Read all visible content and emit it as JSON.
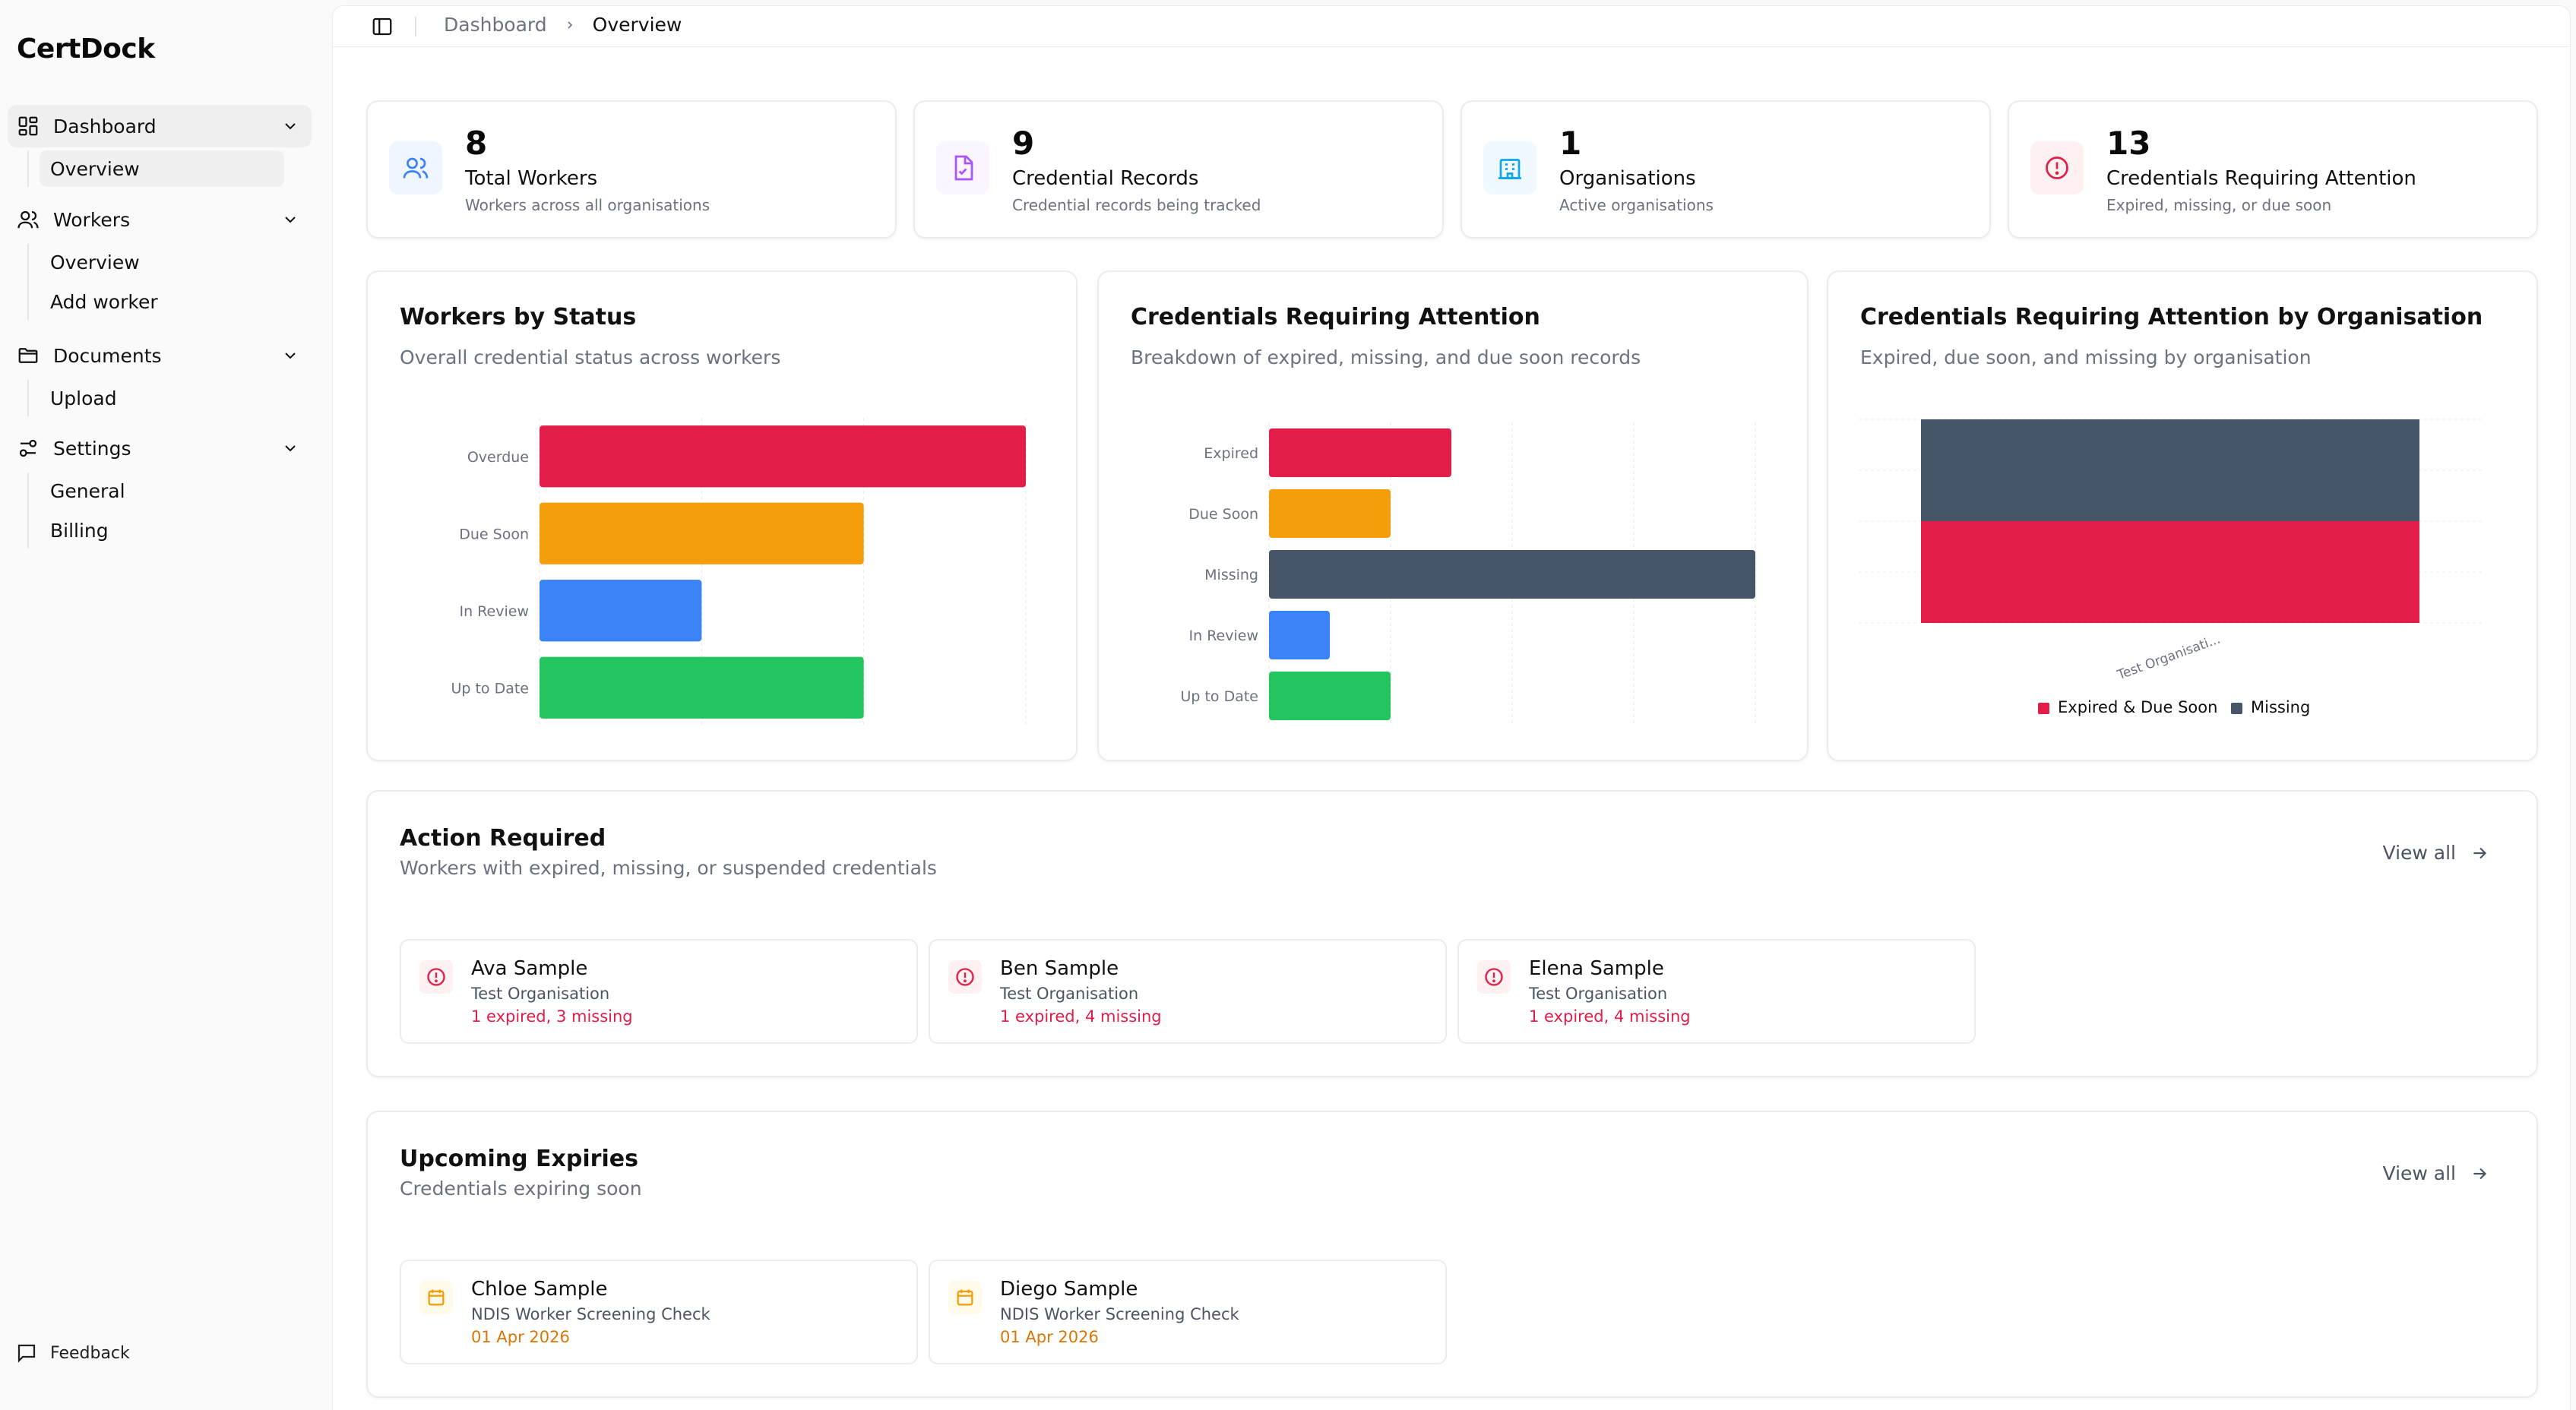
{
  "app": {
    "brand": "CertDock"
  },
  "sidebar": {
    "groups": [
      {
        "label": "Dashboard",
        "icon": "dashboard-icon",
        "items": [
          {
            "label": "Overview"
          }
        ]
      },
      {
        "label": "Workers",
        "icon": "users-icon",
        "items": [
          {
            "label": "Overview"
          },
          {
            "label": "Add worker"
          }
        ]
      },
      {
        "label": "Documents",
        "icon": "folder-icon",
        "items": [
          {
            "label": "Upload"
          }
        ]
      },
      {
        "label": "Settings",
        "icon": "sliders-icon",
        "items": [
          {
            "label": "General"
          },
          {
            "label": "Billing"
          }
        ]
      }
    ],
    "feedback": "Feedback"
  },
  "breadcrumb": {
    "parent": "Dashboard",
    "current": "Overview"
  },
  "stats": [
    {
      "value": "8",
      "label": "Total Workers",
      "desc": "Workers across all organisations",
      "icon": "users-icon",
      "color": "#3b82f6"
    },
    {
      "value": "9",
      "label": "Credential Records",
      "desc": "Credential records being tracked",
      "icon": "file-check-icon",
      "color": "#a855f7"
    },
    {
      "value": "1",
      "label": "Organisations",
      "desc": "Active organisations",
      "icon": "building-icon",
      "color": "#0ea5e9"
    },
    {
      "value": "13",
      "label": "Credentials Requiring Attention",
      "desc": "Expired, missing, or due soon",
      "icon": "alert-circle-icon",
      "color": "#e11d48"
    }
  ],
  "charts": {
    "status": {
      "title": "Workers by Status",
      "subtitle": "Overall credential status across workers"
    },
    "attention": {
      "title": "Credentials Requiring Attention",
      "subtitle": "Breakdown of expired, missing, and due soon records"
    },
    "org": {
      "title": "Credentials Requiring Attention by Organisation",
      "subtitle": "Expired, due soon, and missing by organisation"
    }
  },
  "chart_data": [
    {
      "type": "bar",
      "orientation": "horizontal",
      "title": "Workers by Status",
      "categories": [
        "Overdue",
        "Due Soon",
        "In Review",
        "Up to Date"
      ],
      "values": [
        3,
        2,
        1,
        2
      ],
      "colors": [
        "#e11d48",
        "#f59e0b",
        "#3b82f6",
        "#22c55e"
      ],
      "xlim": [
        0,
        3
      ],
      "grid": true
    },
    {
      "type": "bar",
      "orientation": "horizontal",
      "title": "Credentials Requiring Attention",
      "categories": [
        "Expired",
        "Due Soon",
        "Missing",
        "In Review",
        "Up to Date"
      ],
      "values": [
        3,
        2,
        8,
        1,
        2
      ],
      "colors": [
        "#e11d48",
        "#f59e0b",
        "#475569",
        "#3b82f6",
        "#22c55e"
      ],
      "xlim": [
        0,
        8
      ],
      "grid": true
    },
    {
      "type": "bar",
      "stacked": true,
      "title": "Credentials Requiring Attention by Organisation",
      "categories": [
        "Test Organisati..."
      ],
      "series": [
        {
          "name": "Expired & Due Soon",
          "values": [
            5
          ],
          "color": "#e11d48"
        },
        {
          "name": "Missing",
          "values": [
            5
          ],
          "color": "#475569"
        }
      ],
      "ylim": [
        0,
        10
      ],
      "legend": "bottom"
    }
  ],
  "action_required": {
    "title": "Action Required",
    "subtitle": "Workers with expired, missing, or suspended credentials",
    "view_all": "View all",
    "items": [
      {
        "name": "Ava Sample",
        "org": "Test Organisation",
        "status": "1 expired, 3 missing"
      },
      {
        "name": "Ben Sample",
        "org": "Test Organisation",
        "status": "1 expired, 4 missing"
      },
      {
        "name": "Elena Sample",
        "org": "Test Organisation",
        "status": "1 expired, 4 missing"
      }
    ]
  },
  "upcoming": {
    "title": "Upcoming Expiries",
    "subtitle": "Credentials expiring soon",
    "view_all": "View all",
    "items": [
      {
        "name": "Chloe Sample",
        "credential": "NDIS Worker Screening Check",
        "date": "01 Apr 2026"
      },
      {
        "name": "Diego Sample",
        "credential": "NDIS Worker Screening Check",
        "date": "01 Apr 2026"
      }
    ]
  }
}
